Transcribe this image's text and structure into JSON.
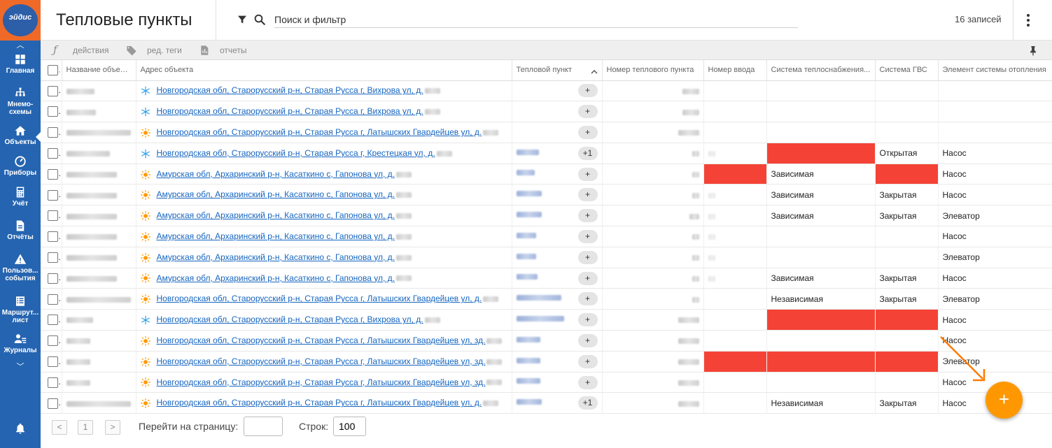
{
  "app": {
    "logo_text": "эйдис"
  },
  "sidebar": {
    "items": [
      {
        "label": "Главная",
        "icon": "grid-icon"
      },
      {
        "label": "Мнемо-схемы",
        "icon": "hierarchy-icon"
      },
      {
        "label": "Объекты",
        "icon": "home-icon"
      },
      {
        "label": "Приборы",
        "icon": "gauge-icon"
      },
      {
        "label": "Учёт",
        "icon": "calculator-icon"
      },
      {
        "label": "Отчёты",
        "icon": "document-icon"
      },
      {
        "label": "Пользов... события",
        "icon": "warning-icon"
      },
      {
        "label": "Маршрут... лист",
        "icon": "list-icon"
      },
      {
        "label": "Журналы",
        "icon": "user-list-icon"
      }
    ],
    "active": "Объекты"
  },
  "header": {
    "title": "Тепловые пункты",
    "search_placeholder": "Поиск и фильтр",
    "records": "16 записей"
  },
  "toolbar": {
    "actions": "действия",
    "edit_tags": "ред. теги",
    "reports": "отчеты"
  },
  "table": {
    "columns": [
      "Название объекта",
      "Адрес объекта",
      "Тепловой пункт",
      "Номер теплового пункта",
      "Номер ввода",
      "Система теплоснабжения...",
      "Система ГВС",
      "Элемент системы отопления"
    ],
    "rows": [
      {
        "icon": "snowflake",
        "address": "Новгородская обл, Старорусский р-н, Старая Русса г, Вихрова ул, д.",
        "pill": "+",
        "supply": "",
        "gvs": "",
        "element": "",
        "red": []
      },
      {
        "icon": "snowflake",
        "address": "Новгородская обл, Старорусский р-н, Старая Русса г, Вихрова ул, д.",
        "pill": "+",
        "supply": "",
        "gvs": "",
        "element": "",
        "red": []
      },
      {
        "icon": "sun",
        "address": "Новгородская обл, Старорусский р-н, Старая Русса г, Латышских Гвардейцев ул, д.",
        "pill": "+",
        "supply": "",
        "gvs": "",
        "element": "",
        "red": []
      },
      {
        "icon": "snowflake",
        "address": "Новгородская обл, Старорусский р-н, Старая Русса г, Крестецкая ул, д.",
        "pill": "+1",
        "supply": "",
        "gvs": "Открытая",
        "element": "Насос",
        "red": [
          "supply"
        ]
      },
      {
        "icon": "sun",
        "address": "Амурская обл, Архаринский р-н, Касаткино с, Гапонова ул, д.",
        "pill": "+",
        "supply": "Зависимая",
        "gvs": "",
        "element": "Насос",
        "red": [
          "input",
          "gvs"
        ]
      },
      {
        "icon": "sun",
        "address": "Амурская обл, Архаринский р-н, Касаткино с, Гапонова ул, д.",
        "pill": "+",
        "supply": "Зависимая",
        "gvs": "Закрытая",
        "element": "Насос",
        "red": []
      },
      {
        "icon": "sun",
        "address": "Амурская обл, Архаринский р-н, Касаткино с, Гапонова ул, д.",
        "pill": "+",
        "supply": "Зависимая",
        "gvs": "Закрытая",
        "element": "Элеватор",
        "red": []
      },
      {
        "icon": "sun",
        "address": "Амурская обл, Архаринский р-н, Касаткино с, Гапонова ул, д.",
        "pill": "+",
        "supply": "",
        "gvs": "",
        "element": "Насос",
        "red": []
      },
      {
        "icon": "sun",
        "address": "Амурская обл, Архаринский р-н, Касаткино с, Гапонова ул, д.",
        "pill": "+",
        "supply": "",
        "gvs": "",
        "element": "Элеватор",
        "red": []
      },
      {
        "icon": "sun",
        "address": "Амурская обл, Архаринский р-н, Касаткино с, Гапонова ул, д.",
        "pill": "+",
        "supply": "Зависимая",
        "gvs": "Закрытая",
        "element": "Насос",
        "red": []
      },
      {
        "icon": "sun",
        "address": "Новгородская обл, Старорусский р-н, Старая Русса г, Латышских Гвардейцев ул, д.",
        "pill": "+",
        "supply": "Независимая",
        "gvs": "Закрытая",
        "element": "Элеватор",
        "red": []
      },
      {
        "icon": "snowflake",
        "address": "Новгородская обл, Старорусский р-н, Старая Русса г, Вихрова ул, д.",
        "pill": "+",
        "supply": "",
        "gvs": "",
        "element": "Насос",
        "red": [
          "supply",
          "gvs"
        ]
      },
      {
        "icon": "sun",
        "address": "Новгородская обл, Старорусский р-н, Старая Русса г, Латышских Гвардейцев ул, зд.",
        "pill": "+",
        "supply": "",
        "gvs": "",
        "element": "Насос",
        "red": []
      },
      {
        "icon": "sun",
        "address": "Новгородская обл, Старорусский р-н, Старая Русса г, Латышских Гвардейцев ул, зд.",
        "pill": "+",
        "supply": "",
        "gvs": "",
        "element": "Элеватор",
        "red": [
          "input",
          "supply",
          "gvs"
        ]
      },
      {
        "icon": "sun",
        "address": "Новгородская обл, Старорусский р-н, Старая Русса г, Латышских Гвардейцев ул, зд.",
        "pill": "+",
        "supply": "",
        "gvs": "",
        "element": "Насос",
        "red": []
      },
      {
        "icon": "sun",
        "address": "Новгородская обл, Старорусский р-н, Старая Русса г, Латышских Гвардейцев ул, д.",
        "pill": "+1",
        "supply": "Независимая",
        "gvs": "Закрытая",
        "element": "Насос",
        "red": []
      }
    ]
  },
  "pager": {
    "prev": "<",
    "page": "1",
    "next": ">",
    "goto_label": "Перейти на страницу:",
    "goto_value": "",
    "rows_label": "Строк:",
    "rows_value": "100"
  },
  "fab": {
    "label": "+"
  },
  "colors": {
    "sidebar": "#2564b0",
    "accent": "#ff9800",
    "error": "#f44336",
    "link": "#1565c0"
  }
}
